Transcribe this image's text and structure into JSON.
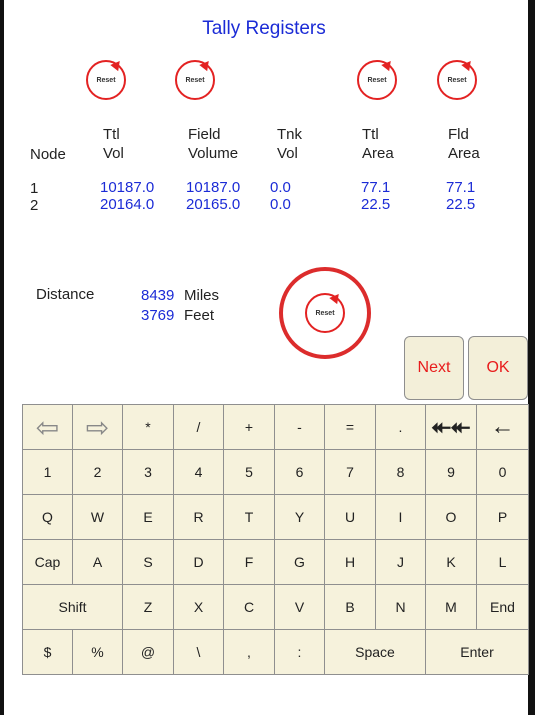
{
  "title": "Tally Registers",
  "reset_label": "Reset",
  "headers": {
    "node": "Node",
    "ttl_vol": [
      "Ttl",
      "Vol"
    ],
    "field_volume": [
      "Field",
      "Volume"
    ],
    "tnk_vol": [
      "Tnk",
      "Vol"
    ],
    "ttl_area": [
      "Ttl",
      "Area"
    ],
    "fld_area": [
      "Fld",
      "Area"
    ]
  },
  "rows": [
    {
      "node": "1",
      "ttl_vol": "10187.0",
      "field_volume": "10187.0",
      "tnk_vol": "0.0",
      "ttl_area": "77.1",
      "fld_area": "77.1"
    },
    {
      "node": "2",
      "ttl_vol": "20164.0",
      "field_volume": "20165.0",
      "tnk_vol": "0.0",
      "ttl_area": "22.5",
      "fld_area": "22.5"
    }
  ],
  "distance": {
    "label": "Distance",
    "miles_value": "8439",
    "miles_unit": "Miles",
    "feet_value": "3769",
    "feet_unit": "Feet"
  },
  "buttons": {
    "next": "Next",
    "ok": "OK"
  },
  "keyboard": {
    "row1": [
      "⇦",
      "⇨",
      "*",
      "/",
      "+",
      "-",
      "=",
      ".",
      "⯬⯬",
      "←"
    ],
    "row2": [
      "1",
      "2",
      "3",
      "4",
      "5",
      "6",
      "7",
      "8",
      "9",
      "0"
    ],
    "row3": [
      "Q",
      "W",
      "E",
      "R",
      "T",
      "Y",
      "U",
      "I",
      "O",
      "P"
    ],
    "row4": [
      "Cap",
      "A",
      "S",
      "D",
      "F",
      "G",
      "H",
      "J",
      "K",
      "L"
    ],
    "row5": [
      "Shift",
      "Z",
      "X",
      "C",
      "V",
      "B",
      "N",
      "M",
      "End"
    ],
    "row6": [
      "$",
      "%",
      "@",
      "\\",
      ",",
      ":",
      "Space",
      "Enter"
    ]
  },
  "colors": {
    "accent_blue": "#1b2bd6",
    "reset_red": "#e32222",
    "key_bg": "#f6f2dc"
  }
}
